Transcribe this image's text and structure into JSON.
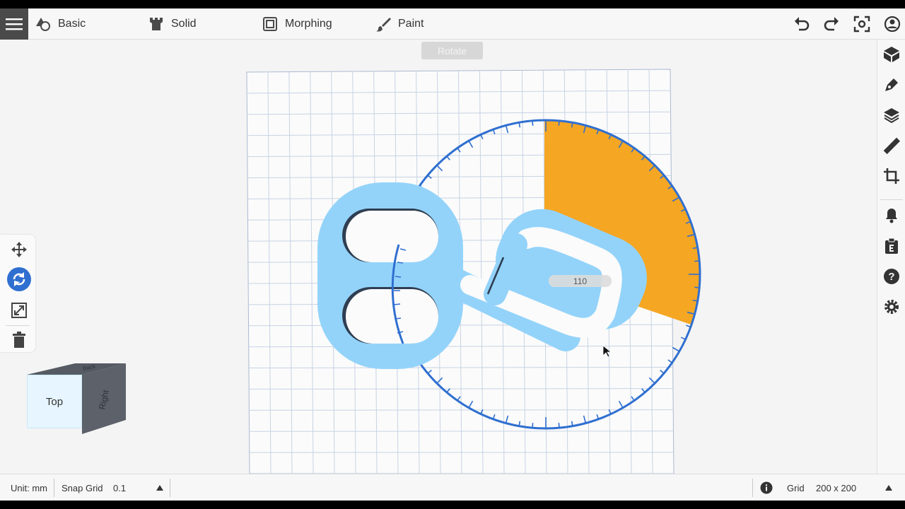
{
  "toolbar": {
    "tools": [
      {
        "label": "Basic",
        "icon": "basic-shapes-icon"
      },
      {
        "label": "Solid",
        "icon": "castle-tower-icon"
      },
      {
        "label": "Morphing",
        "icon": "morph-icon"
      },
      {
        "label": "Paint",
        "icon": "paintbrush-icon"
      }
    ],
    "actions": [
      "undo-icon",
      "redo-icon",
      "fit-view-icon",
      "account-icon"
    ]
  },
  "viewport": {
    "mode_chip": "Rotate",
    "rotation_readout": "110"
  },
  "left_tools": [
    "move-icon",
    "rotate-icon",
    "scale-icon",
    "delete-icon"
  ],
  "view_cube": {
    "front": "Top",
    "side": "Right",
    "top": "Back"
  },
  "right_sidebar": [
    "box-3d-icon",
    "pen-tool-icon",
    "layers-icon",
    "ruler-icon",
    "crop-icon",
    "bell-icon",
    "clipboard-icon",
    "help-icon",
    "settings-icon"
  ],
  "statusbar": {
    "unit": "Unit: mm",
    "snap_label": "Snap Grid",
    "snap_value": "0.1",
    "grid_label": "Grid",
    "grid_value": "200 x 200"
  },
  "colors": {
    "accent_blue": "#2f6fd0",
    "shape_fill": "#93d3fa",
    "rotation_sweep": "#f5a623"
  }
}
